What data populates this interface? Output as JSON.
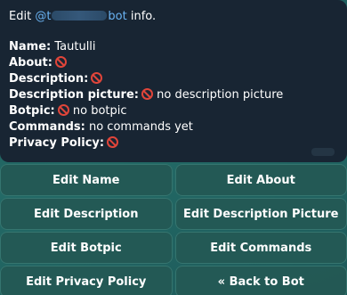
{
  "message": {
    "header_prefix": "Edit ",
    "mention_start": "@t",
    "mention_end": "bot",
    "header_suffix": " info.",
    "fields": [
      {
        "label": "Name:",
        "value": "Tautulli",
        "empty": false
      },
      {
        "label": "About:",
        "value": "",
        "empty": true
      },
      {
        "label": "Description:",
        "value": "",
        "empty": true
      },
      {
        "label": "Description picture:",
        "value": "no description picture",
        "empty": true
      },
      {
        "label": "Botpic:",
        "value": "no botpic",
        "empty": true
      },
      {
        "label": "Commands:",
        "value": "no commands yet",
        "empty": false
      },
      {
        "label": "Privacy Policy:",
        "value": "",
        "empty": true
      }
    ]
  },
  "keyboard": {
    "edit_name": "Edit Name",
    "edit_about": "Edit About",
    "edit_description": "Edit Description",
    "edit_description_picture": "Edit Description Picture",
    "edit_botpic": "Edit Botpic",
    "edit_commands": "Edit Commands",
    "edit_privacy_policy": "Edit Privacy Policy",
    "back_to_bot": "« Back to Bot"
  },
  "icons": {
    "empty_value": "prohibited-icon"
  },
  "colors": {
    "mention": "#6ab3f3",
    "prohibited": "#e0453a"
  }
}
